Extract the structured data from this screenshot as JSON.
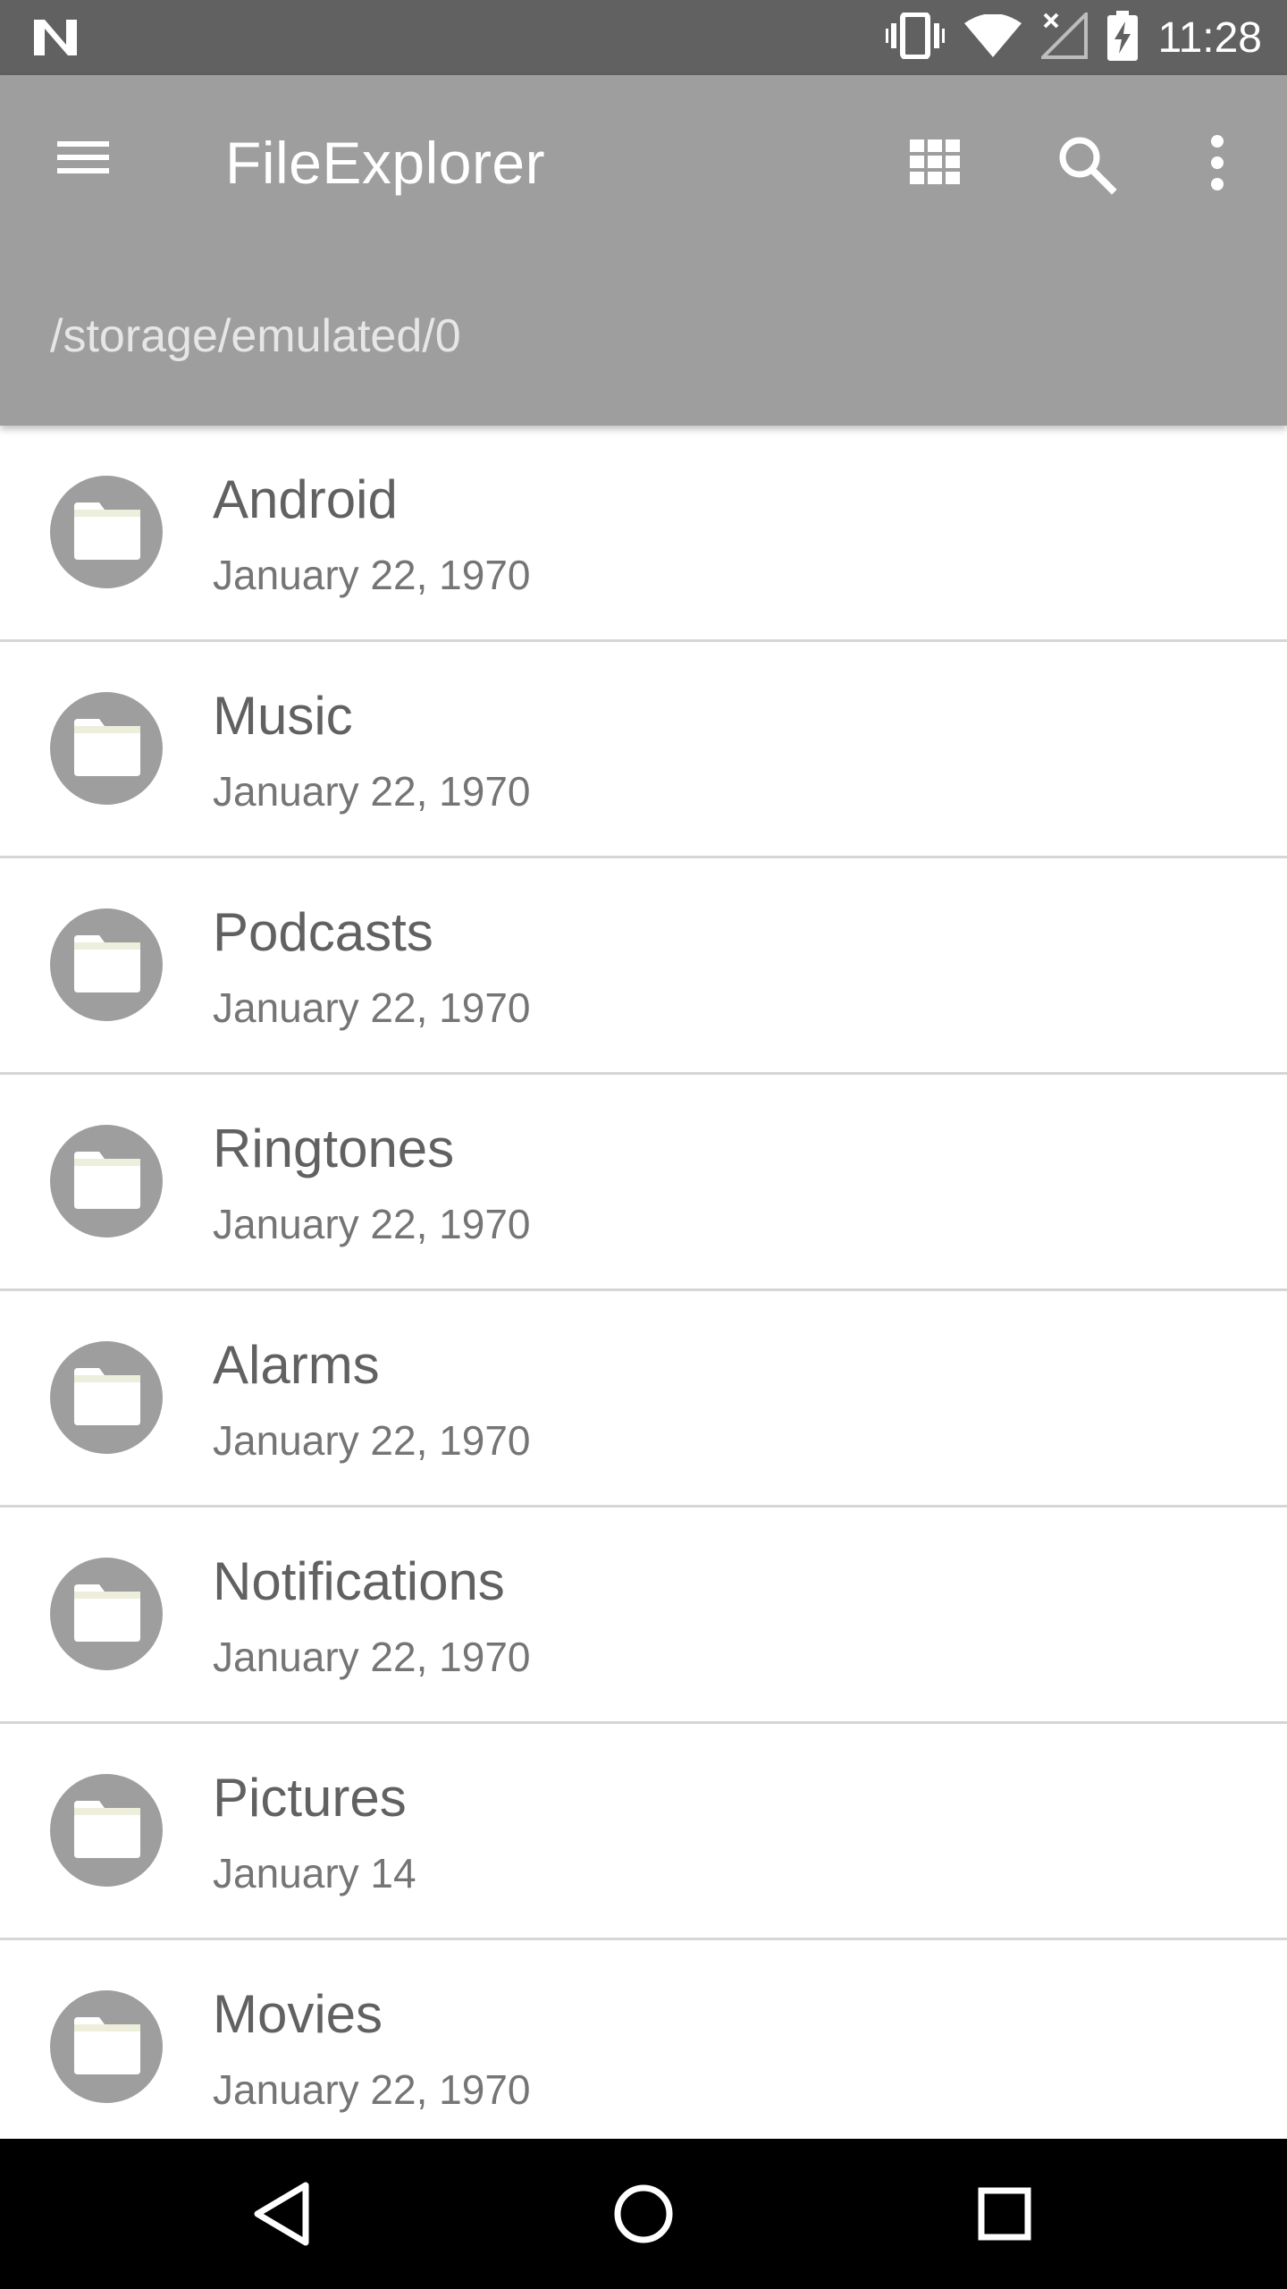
{
  "status_bar": {
    "time": "11:28",
    "icons": [
      "notification-n-icon",
      "vibrate-icon",
      "wifi-icon",
      "no-signal-icon",
      "battery-charging-icon"
    ]
  },
  "app_bar": {
    "title": "FileExplorer",
    "path": "/storage/emulated/0",
    "color": "#9e9e9e",
    "actions": [
      "grid-view-icon",
      "search-icon",
      "more-vert-icon"
    ]
  },
  "files": [
    {
      "name": "Android",
      "date": "January 22, 1970"
    },
    {
      "name": "Music",
      "date": "January 22, 1970"
    },
    {
      "name": "Podcasts",
      "date": "January 22, 1970"
    },
    {
      "name": "Ringtones",
      "date": "January 22, 1970"
    },
    {
      "name": "Alarms",
      "date": "January 22, 1970"
    },
    {
      "name": "Notifications",
      "date": "January 22, 1970"
    },
    {
      "name": "Pictures",
      "date": "January 14"
    },
    {
      "name": "Movies",
      "date": "January 22, 1970"
    }
  ],
  "nav_bar": {
    "buttons": [
      "back-icon",
      "home-icon",
      "recents-icon"
    ]
  }
}
